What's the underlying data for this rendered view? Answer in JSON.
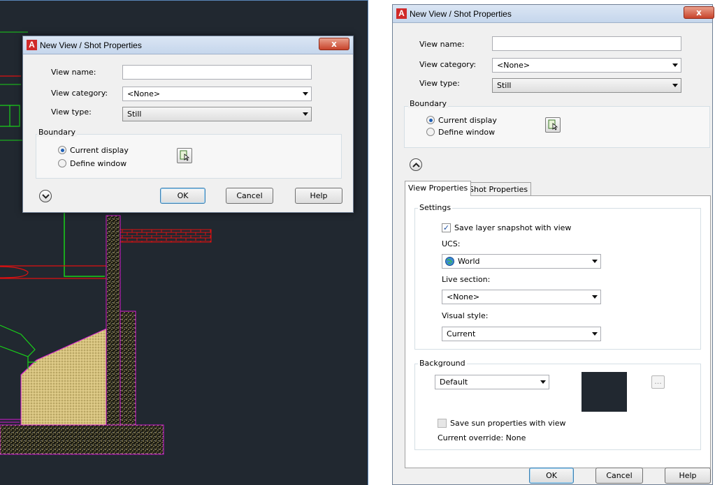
{
  "small_dialog": {
    "title": "New View / Shot Properties",
    "close_label": "x",
    "view_name_label": "View name:",
    "view_name_value": "",
    "view_category_label": "View category:",
    "view_category_value": "<None>",
    "view_type_label": "View type:",
    "view_type_value": "Still",
    "boundary_label": "Boundary",
    "current_display_label": "Current display",
    "define_window_label": "Define window",
    "ok_label": "OK",
    "cancel_label": "Cancel",
    "help_label": "Help"
  },
  "large_dialog": {
    "title": "New View / Shot Properties",
    "close_label": "x",
    "view_name_label": "View name:",
    "view_name_value": "",
    "view_category_label": "View category:",
    "view_category_value": "<None>",
    "view_type_label": "View type:",
    "view_type_value": "Still",
    "boundary_label": "Boundary",
    "current_display_label": "Current display",
    "define_window_label": "Define window",
    "tabs": [
      {
        "label": "View Properties",
        "active": true
      },
      {
        "label": "Shot Properties",
        "active": false
      }
    ],
    "settings_label": "Settings",
    "save_layer_snapshot_label": "Save layer snapshot with view",
    "save_layer_snapshot_checked": true,
    "ucs_label": "UCS:",
    "ucs_value": "World",
    "live_section_label": "Live section:",
    "live_section_value": "<None>",
    "visual_style_label": "Visual style:",
    "visual_style_value": "Current",
    "background_label": "Background",
    "background_value": "Default",
    "ellipsis_label": "...",
    "save_sun_label": "Save sun properties with view",
    "save_sun_checked": false,
    "current_override_label": "Current override: None",
    "ok_label": "OK",
    "cancel_label": "Cancel",
    "help_label": "Help"
  },
  "colors": {
    "canvas_background": "#212830",
    "background_swatch": "#212830",
    "cad_green": "#19d119",
    "cad_red": "#e01010",
    "cad_magenta": "#d21ad2",
    "cad_hatch": "#e3d089",
    "app_icon_red": "#d02a2a"
  },
  "icons": {
    "app": "autocad-logo-icon",
    "pick": "define-window-pick-icon",
    "expander_small": "chevron-down-circle-icon",
    "expander_large": "chevron-up-circle-icon",
    "ucs": "globe-icon"
  }
}
